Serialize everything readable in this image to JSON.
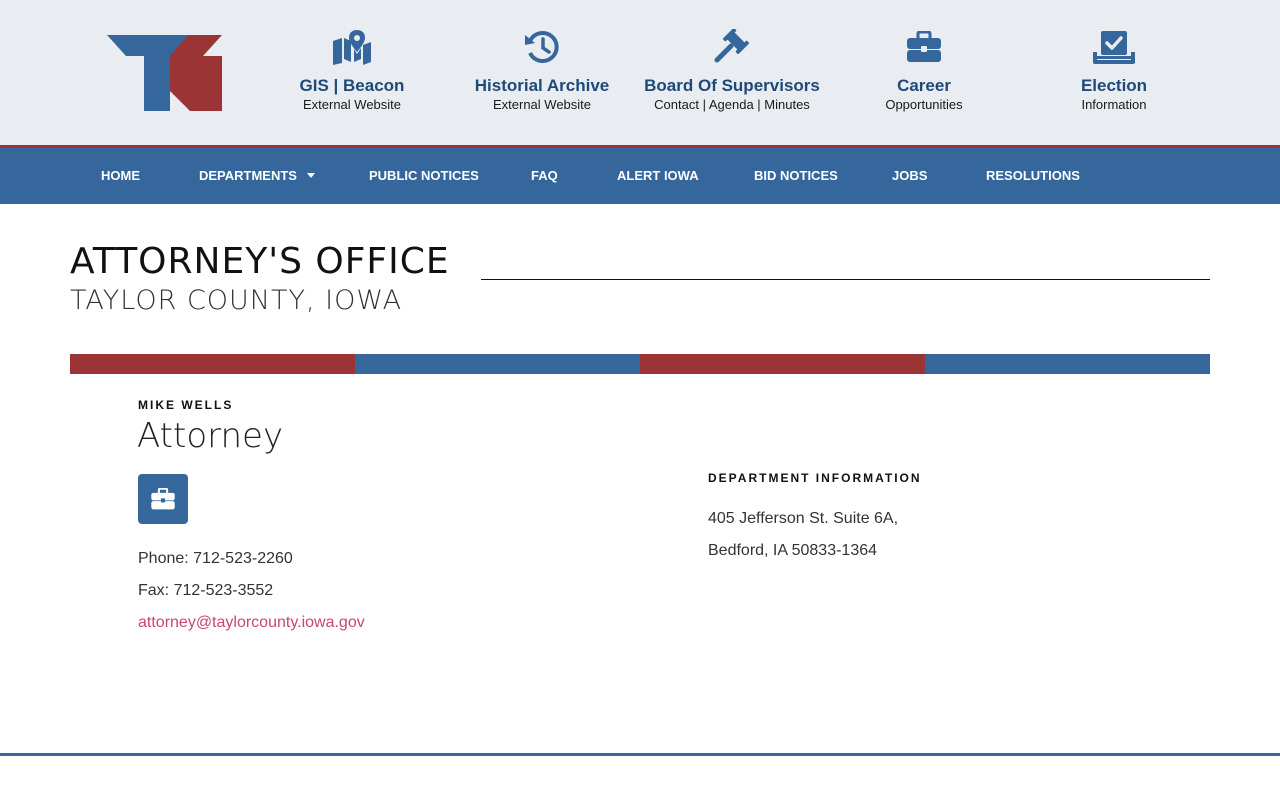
{
  "colors": {
    "blue": "#35679c",
    "red": "#9b3434",
    "link": "#c8457a",
    "topbar": "#e9ecf0"
  },
  "header": {
    "logo_icon": "county-logo-icon",
    "quick_links": [
      {
        "icon": "map-pin-icon",
        "title": "GIS | Beacon",
        "subtitle": "External Website"
      },
      {
        "icon": "history-icon",
        "title": "Historial Archive",
        "subtitle": "External Website"
      },
      {
        "icon": "gavel-icon",
        "title": "Board Of Supervisors",
        "subtitle": "Contact | Agenda | Minutes"
      },
      {
        "icon": "briefcase-icon",
        "title": "Career",
        "subtitle": "Opportunities"
      },
      {
        "icon": "vote-box-icon",
        "title": "Election",
        "subtitle": "Information"
      }
    ]
  },
  "nav": {
    "items": [
      "HOME",
      "DEPARTMENTS",
      "PUBLIC NOTICES",
      "FAQ",
      "ALERT IOWA",
      "BID NOTICES",
      "JOBS",
      "RESOLUTIONS"
    ],
    "dropdown_icon": "caret-down-icon"
  },
  "page": {
    "title": "ATTORNEY'S OFFICE",
    "subtitle": "TAYLOR COUNTY, IOWA"
  },
  "contact": {
    "name": "MIKE WELLS",
    "role": "Attorney",
    "icon": "briefcase-icon",
    "phone": "Phone: 712-523-2260",
    "fax": "Fax: 712-523-3552",
    "email": "attorney@taylorcounty.iowa.gov"
  },
  "department": {
    "heading": "DEPARTMENT INFORMATION",
    "address_line1": "405 Jefferson St. Suite 6A,",
    "address_line2": "Bedford, IA 50833-1364"
  }
}
